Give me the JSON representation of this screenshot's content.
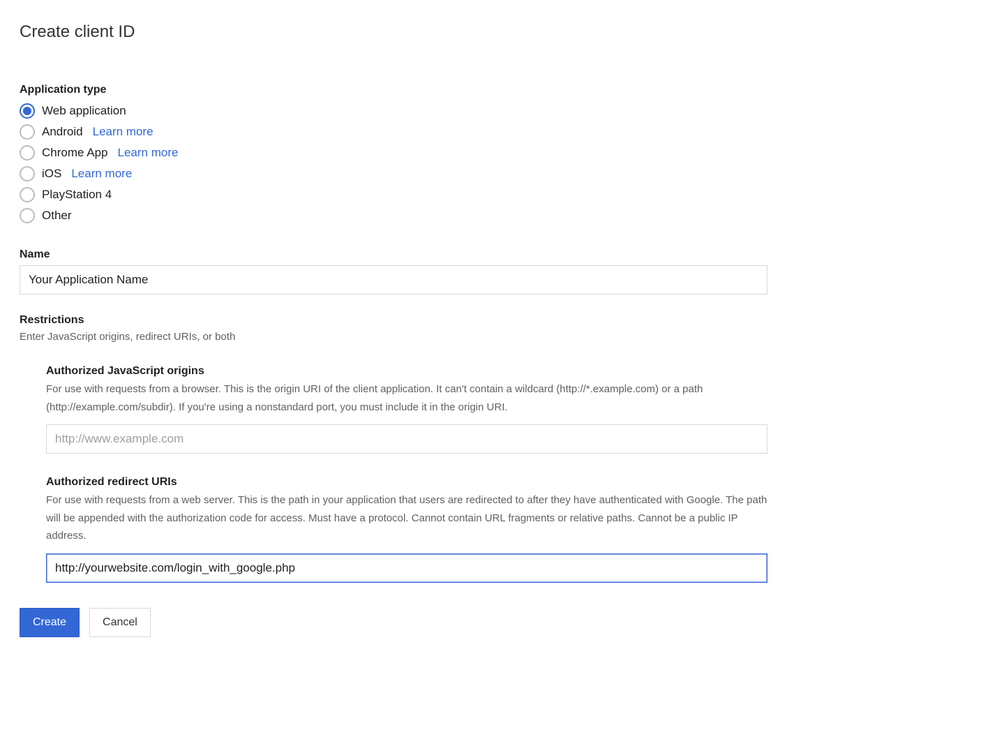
{
  "page": {
    "title": "Create client ID"
  },
  "appType": {
    "label": "Application type",
    "learnMoreText": "Learn more",
    "options": [
      {
        "label": "Web application",
        "selected": true,
        "learnMore": false
      },
      {
        "label": "Android",
        "selected": false,
        "learnMore": true
      },
      {
        "label": "Chrome App",
        "selected": false,
        "learnMore": true
      },
      {
        "label": "iOS",
        "selected": false,
        "learnMore": true
      },
      {
        "label": "PlayStation 4",
        "selected": false,
        "learnMore": false
      },
      {
        "label": "Other",
        "selected": false,
        "learnMore": false
      }
    ]
  },
  "name": {
    "label": "Name",
    "value": "Your Application Name"
  },
  "restrictions": {
    "label": "Restrictions",
    "hint": "Enter JavaScript origins, redirect URIs, or both",
    "jsOrigins": {
      "title": "Authorized JavaScript origins",
      "desc": "For use with requests from a browser. This is the origin URI of the client application. It can't contain a wildcard (http://*.example.com) or a path (http://example.com/subdir). If you're using a nonstandard port, you must include it in the origin URI.",
      "placeholder": "http://www.example.com",
      "value": ""
    },
    "redirectUris": {
      "title": "Authorized redirect URIs",
      "desc": "For use with requests from a web server. This is the path in your application that users are redirected to after they have authenticated with Google. The path will be appended with the authorization code for access. Must have a protocol. Cannot contain URL fragments or relative paths. Cannot be a public IP address.",
      "value": "http://yourwebsite.com/login_with_google.php"
    }
  },
  "buttons": {
    "create": "Create",
    "cancel": "Cancel"
  }
}
